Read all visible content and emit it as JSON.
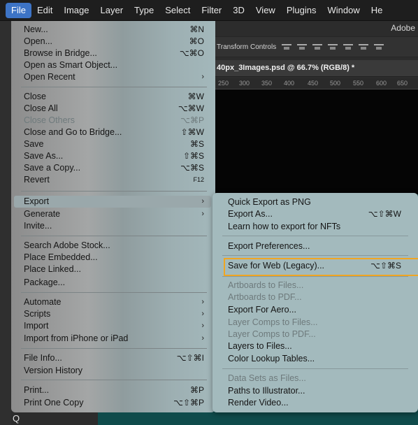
{
  "menubar": {
    "items": [
      "File",
      "Edit",
      "Image",
      "Layer",
      "Type",
      "Select",
      "Filter",
      "3D",
      "View",
      "Plugins",
      "Window",
      "He"
    ]
  },
  "app": {
    "name": "Adobe",
    "options_transform": "Transform Controls",
    "doc_tab": "40px_3Images.psd @ 66.7% (RGB/8) *",
    "ruler_ticks": [
      "250",
      "300",
      "350",
      "400",
      "450",
      "500",
      "550",
      "600",
      "650"
    ],
    "search_glyph": "Q"
  },
  "file_menu": {
    "items": [
      {
        "label": "New...",
        "shortcut": "⌘N"
      },
      {
        "label": "Open...",
        "shortcut": "⌘O"
      },
      {
        "label": "Browse in Bridge...",
        "shortcut": "⌥⌘O"
      },
      {
        "label": "Open as Smart Object...",
        "shortcut": ""
      },
      {
        "label": "Open Recent",
        "shortcut": "",
        "submenu": true
      },
      {
        "label": "Close",
        "shortcut": "⌘W"
      },
      {
        "label": "Close All",
        "shortcut": "⌥⌘W"
      },
      {
        "label": "Close Others",
        "shortcut": "⌥⌘P",
        "disabled": true
      },
      {
        "label": "Close and Go to Bridge...",
        "shortcut": "⇧⌘W"
      },
      {
        "label": "Save",
        "shortcut": "⌘S"
      },
      {
        "label": "Save As...",
        "shortcut": "⇧⌘S"
      },
      {
        "label": "Save a Copy...",
        "shortcut": "⌥⌘S"
      },
      {
        "label": "Revert",
        "shortcut": "F12"
      },
      {
        "label": "Export",
        "shortcut": "",
        "submenu": true,
        "highlighted": true
      },
      {
        "label": "Generate",
        "shortcut": "",
        "submenu": true
      },
      {
        "label": "Invite...",
        "shortcut": ""
      },
      {
        "label": "Search Adobe Stock...",
        "shortcut": ""
      },
      {
        "label": "Place Embedded...",
        "shortcut": ""
      },
      {
        "label": "Place Linked...",
        "shortcut": ""
      },
      {
        "label": "Package...",
        "shortcut": ""
      },
      {
        "label": "Automate",
        "shortcut": "",
        "submenu": true
      },
      {
        "label": "Scripts",
        "shortcut": "",
        "submenu": true
      },
      {
        "label": "Import",
        "shortcut": "",
        "submenu": true
      },
      {
        "label": "Import from iPhone or iPad",
        "shortcut": "",
        "submenu": true
      },
      {
        "label": "File Info...",
        "shortcut": "⌥⇧⌘I"
      },
      {
        "label": "Version History",
        "shortcut": ""
      },
      {
        "label": "Print...",
        "shortcut": "⌘P"
      },
      {
        "label": "Print One Copy",
        "shortcut": "⌥⇧⌘P"
      }
    ]
  },
  "export_submenu": {
    "items": [
      {
        "label": "Quick Export as PNG",
        "shortcut": ""
      },
      {
        "label": "Export As...",
        "shortcut": "⌥⇧⌘W"
      },
      {
        "label": "Learn how to export for NFTs",
        "shortcut": ""
      },
      {
        "label": "Export Preferences...",
        "shortcut": ""
      },
      {
        "label": "Save for Web (Legacy)...",
        "shortcut": "⌥⇧⌘S",
        "outlined": true
      },
      {
        "label": "Artboards to Files...",
        "shortcut": "",
        "disabled": true
      },
      {
        "label": "Artboards to PDF...",
        "shortcut": "",
        "disabled": true
      },
      {
        "label": "Export For Aero...",
        "shortcut": ""
      },
      {
        "label": "Layer Comps to Files...",
        "shortcut": "",
        "disabled": true
      },
      {
        "label": "Layer Comps to PDF...",
        "shortcut": "",
        "disabled": true
      },
      {
        "label": "Layers to Files...",
        "shortcut": ""
      },
      {
        "label": "Color Lookup Tables...",
        "shortcut": ""
      },
      {
        "label": "Data Sets as Files...",
        "shortcut": "",
        "disabled": true
      },
      {
        "label": "Paths to Illustrator...",
        "shortcut": ""
      },
      {
        "label": "Render Video...",
        "shortcut": ""
      }
    ]
  },
  "colors": {
    "menu_active": "#3d74c6",
    "highlight_outline": "#f0a622",
    "canvas_teal": "#0f4b4b"
  },
  "submenu_arrow": "›"
}
